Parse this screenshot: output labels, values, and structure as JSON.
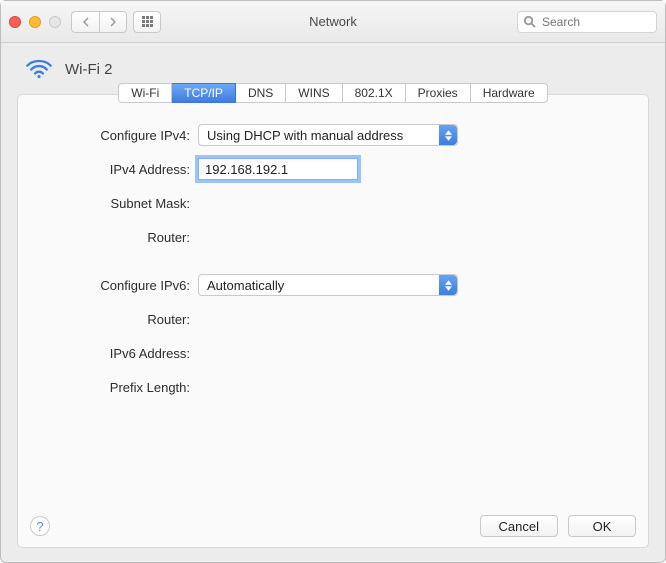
{
  "window": {
    "title": "Network",
    "search_placeholder": "Search"
  },
  "header": {
    "interface_name": "Wi-Fi 2"
  },
  "tabs": [
    "Wi-Fi",
    "TCP/IP",
    "DNS",
    "WINS",
    "802.1X",
    "Proxies",
    "Hardware"
  ],
  "tabs_selected_index": 1,
  "form": {
    "labels": {
      "configure_ipv4": "Configure IPv4:",
      "ipv4_address": "IPv4 Address:",
      "subnet_mask": "Subnet Mask:",
      "router_v4": "Router:",
      "configure_ipv6": "Configure IPv6:",
      "router_v6": "Router:",
      "ipv6_address": "IPv6 Address:",
      "prefix_length": "Prefix Length:"
    },
    "values": {
      "configure_ipv4": "Using DHCP with manual address",
      "ipv4_address": "192.168.192.1",
      "subnet_mask": "",
      "router_v4": "",
      "configure_ipv6": "Automatically",
      "router_v6": "",
      "ipv6_address": "",
      "prefix_length": ""
    }
  },
  "footer": {
    "help": "?",
    "cancel": "Cancel",
    "ok": "OK"
  }
}
